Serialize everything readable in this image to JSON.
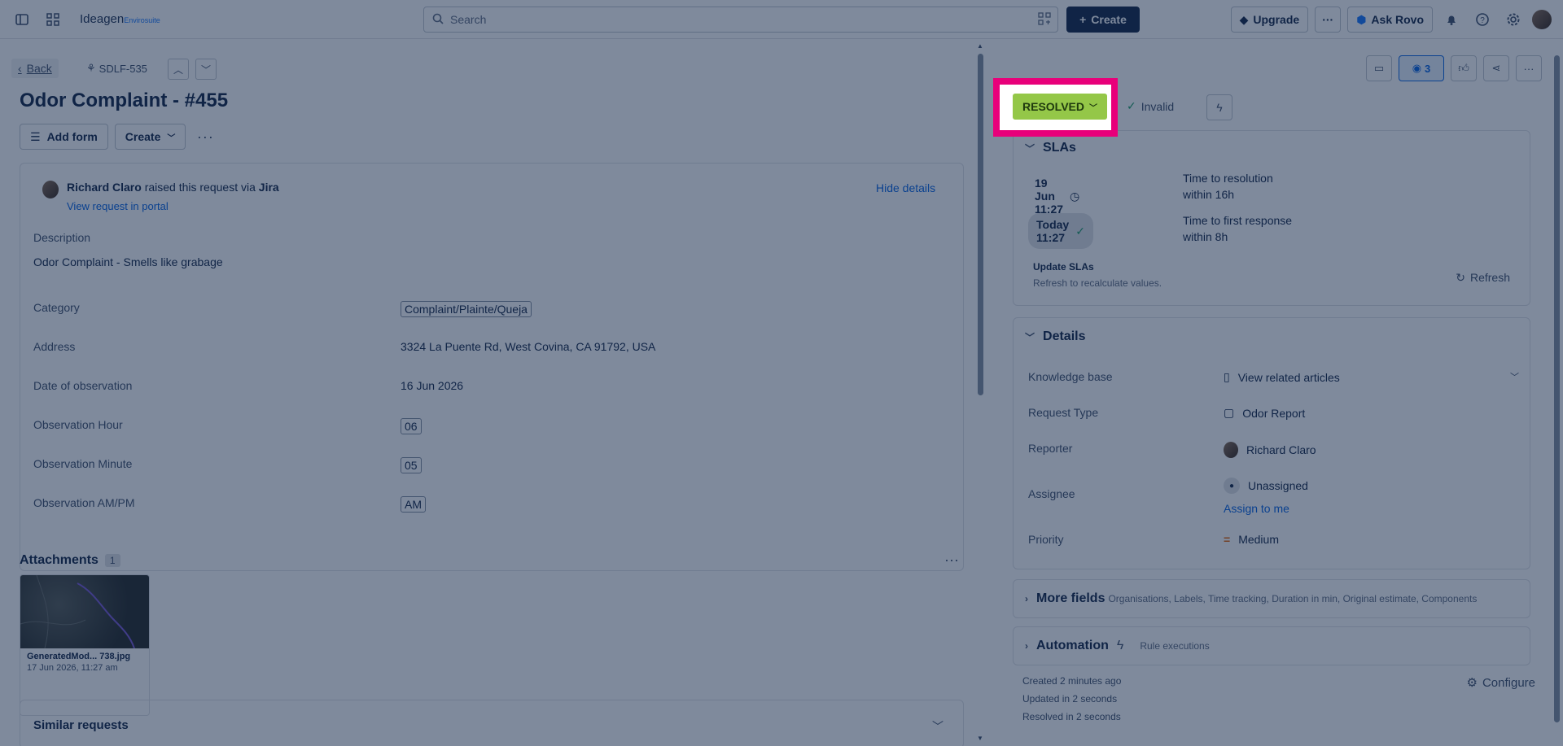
{
  "topbar": {
    "logo_main": "Ideagen",
    "logo_sub": "Envirosuite",
    "search_placeholder": "Search",
    "create_label": "Create",
    "upgrade_label": "Upgrade",
    "ask_rovo_label": "Ask Rovo"
  },
  "issue": {
    "back_label": "Back",
    "key": "SDLF-535",
    "title": "Odor Complaint - #455",
    "add_form_label": "Add form",
    "create_label": "Create"
  },
  "request": {
    "reporter": "Richard Claro",
    "raised_text": "raised this request via",
    "channel": "Jira",
    "portal_link": "View request in portal",
    "hide_details": "Hide details",
    "description_label": "Description",
    "description_value": "Odor Complaint - Smells like grabage",
    "fields": [
      {
        "label": "Category",
        "value": "Complaint/Plainte/Queja"
      },
      {
        "label": "Address",
        "value": "3324 La Puente Rd, West Covina, CA 91792, USA"
      },
      {
        "label": "Date of observation",
        "value": "16 Jun 2026"
      },
      {
        "label": "Observation Hour",
        "value": "06"
      },
      {
        "label": "Observation Minute",
        "value": "05"
      },
      {
        "label": "Observation AM/PM",
        "value": "AM"
      }
    ]
  },
  "attachments": {
    "heading": "Attachments",
    "count": "1",
    "file_name": "GeneratedMod... 738.jpg",
    "file_date": "17 Jun 2026, 11:27 am"
  },
  "similar": {
    "heading": "Similar requests"
  },
  "status": {
    "current": "RESOLVED",
    "resolution": "Invalid",
    "watchers": "3"
  },
  "slas": {
    "heading": "SLAs",
    "rows": [
      {
        "time": "19 Jun 11:27",
        "title": "Time to resolution",
        "within": "within 16h"
      },
      {
        "time": "Today 11:27",
        "title": "Time to first response",
        "within": "within 8h"
      }
    ],
    "update_title": "Update SLAs",
    "update_sub": "Refresh to recalculate values.",
    "refresh_label": "Refresh"
  },
  "details": {
    "heading": "Details",
    "knowledge_label": "Knowledge base",
    "knowledge_value": "View related articles",
    "request_type_label": "Request Type",
    "request_type_value": "Odor Report",
    "reporter_label": "Reporter",
    "reporter_value": "Richard Claro",
    "assignee_label": "Assignee",
    "assignee_value": "Unassigned",
    "assign_to_me": "Assign to me",
    "priority_label": "Priority",
    "priority_value": "Medium"
  },
  "more_fields": {
    "heading": "More fields",
    "sub": "Organisations, Labels, Time tracking, Duration in min, Original estimate, Components"
  },
  "automation": {
    "heading": "Automation",
    "sub": "Rule executions"
  },
  "meta": {
    "created": "Created 2 minutes ago",
    "updated": "Updated in 2 seconds",
    "resolved": "Resolved in 2 seconds",
    "configure": "Configure"
  }
}
